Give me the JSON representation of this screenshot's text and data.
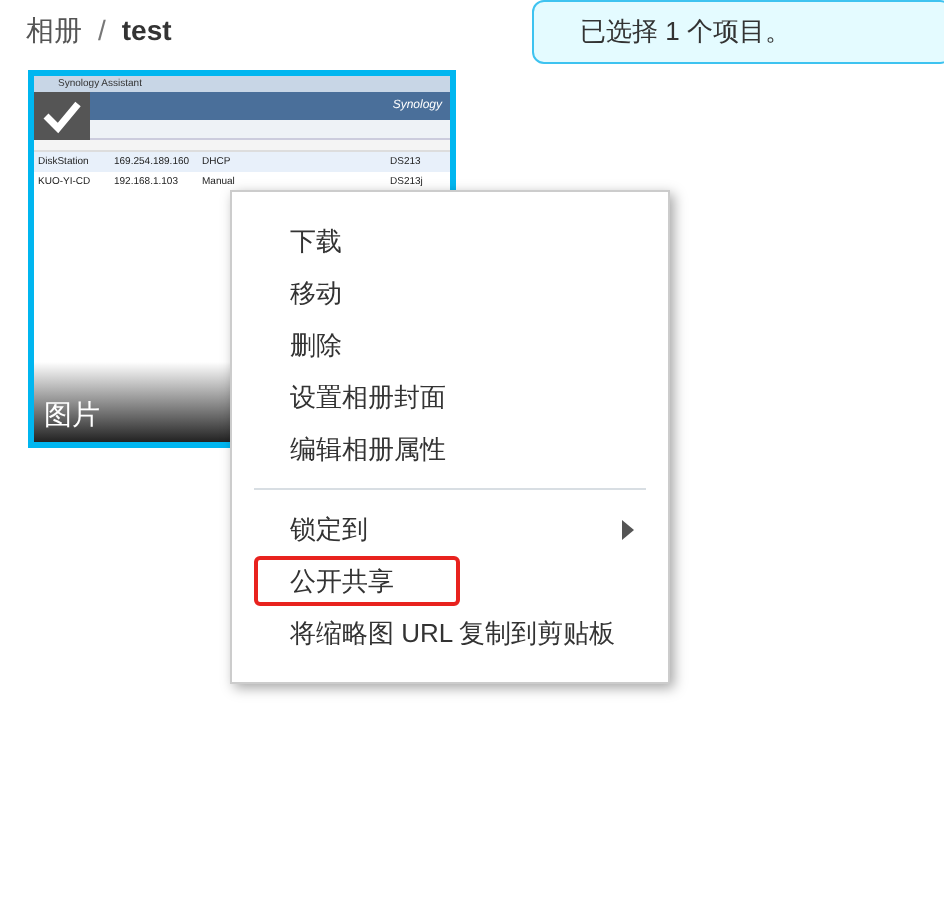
{
  "breadcrumb": {
    "parent": "相册",
    "separator": "/",
    "current": "test"
  },
  "notification": "已选择 1 个项目。",
  "thumbnail": {
    "caption": "图片",
    "selected": true,
    "screenshot": {
      "title": "Synology Assistant",
      "brand": "Synology",
      "rows": [
        [
          "DiskStation",
          "169.254.189.160",
          "DHCP",
          "DS213"
        ],
        [
          "KUO-YI-CD",
          "192.168.1.103",
          "Manual",
          "DS213j"
        ]
      ]
    }
  },
  "context_menu": {
    "items": [
      {
        "kind": "item",
        "label": "下载",
        "highlighted": false
      },
      {
        "kind": "item",
        "label": "移动",
        "highlighted": false
      },
      {
        "kind": "item",
        "label": "删除",
        "highlighted": false
      },
      {
        "kind": "item",
        "label": "设置相册封面",
        "highlighted": false
      },
      {
        "kind": "item",
        "label": "编辑相册属性",
        "highlighted": false
      },
      {
        "kind": "separator"
      },
      {
        "kind": "submenu",
        "label": "锁定到",
        "highlighted": false
      },
      {
        "kind": "item",
        "label": "公开共享",
        "highlighted": true
      },
      {
        "kind": "item",
        "label": "将缩略图 URL 复制到剪贴板",
        "highlighted": false
      }
    ]
  }
}
